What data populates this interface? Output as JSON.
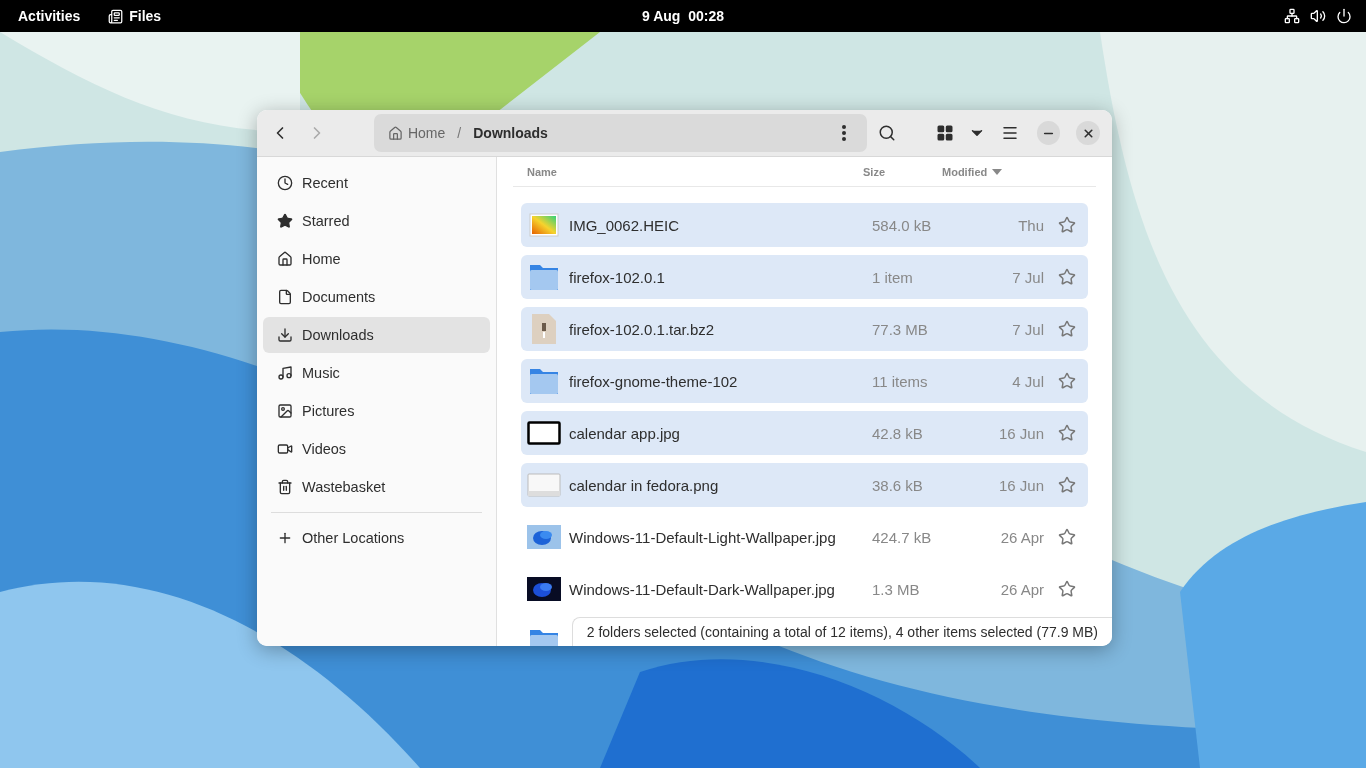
{
  "top_bar": {
    "activities": "Activities",
    "app_name": "Files",
    "clock": "9 Aug  00:28"
  },
  "window": {
    "path": [
      {
        "label": "Home",
        "kind": "home"
      },
      {
        "label": "Downloads",
        "kind": "current"
      }
    ],
    "path_separator": "/",
    "sidebar": {
      "items": [
        {
          "label": "Recent",
          "kind": "recent",
          "selected": false
        },
        {
          "label": "Starred",
          "kind": "starred",
          "selected": false
        },
        {
          "label": "Home",
          "kind": "home",
          "selected": false
        },
        {
          "label": "Documents",
          "kind": "documents",
          "selected": false
        },
        {
          "label": "Downloads",
          "kind": "downloads",
          "selected": true
        },
        {
          "label": "Music",
          "kind": "music",
          "selected": false
        },
        {
          "label": "Pictures",
          "kind": "pictures",
          "selected": false
        },
        {
          "label": "Videos",
          "kind": "videos",
          "selected": false
        },
        {
          "label": "Wastebasket",
          "kind": "trash",
          "selected": false
        }
      ],
      "other_locations": "Other Locations"
    },
    "columns": [
      "Name",
      "Size",
      "Modified"
    ],
    "files": [
      {
        "name": "IMG_0062.HEIC",
        "size": "584.0 kB",
        "modified": "Thu",
        "selected": true
      },
      {
        "name": "firefox-102.0.1",
        "size": "1 item",
        "modified": "7 Jul",
        "kind": "folder",
        "selected": true
      },
      {
        "name": "firefox-102.0.1.tar.bz2",
        "size": "77.3 MB",
        "modified": "7 Jul",
        "kind": "archive",
        "selected": true
      },
      {
        "name": "firefox-gnome-theme-102",
        "size": "11 items",
        "modified": "4 Jul",
        "kind": "folder",
        "selected": true
      },
      {
        "name": "calendar app.jpg",
        "size": "42.8 kB",
        "modified": "16 Jun",
        "kind": "screenshot-dark",
        "selected": true
      },
      {
        "name": "calendar in fedora.png",
        "size": "38.6 kB",
        "modified": "16 Jun",
        "kind": "screenshot-light",
        "selected": true
      },
      {
        "name": "Windows-11-Default-Light-Wallpaper.jpg",
        "size": "424.7 kB",
        "modified": "26 Apr",
        "kind": "wallpaper-light",
        "selected": false
      },
      {
        "name": "Windows-11-Default-Dark-Wallpaper.jpg",
        "size": "1.3 MB",
        "modified": "26 Apr",
        "kind": "wallpaper-dark",
        "selected": false
      }
    ],
    "partial_row": {
      "kind": "folder"
    },
    "status": "2 folders selected (containing a total of 12 items), 4 other items selected (77.9 MB)"
  }
}
